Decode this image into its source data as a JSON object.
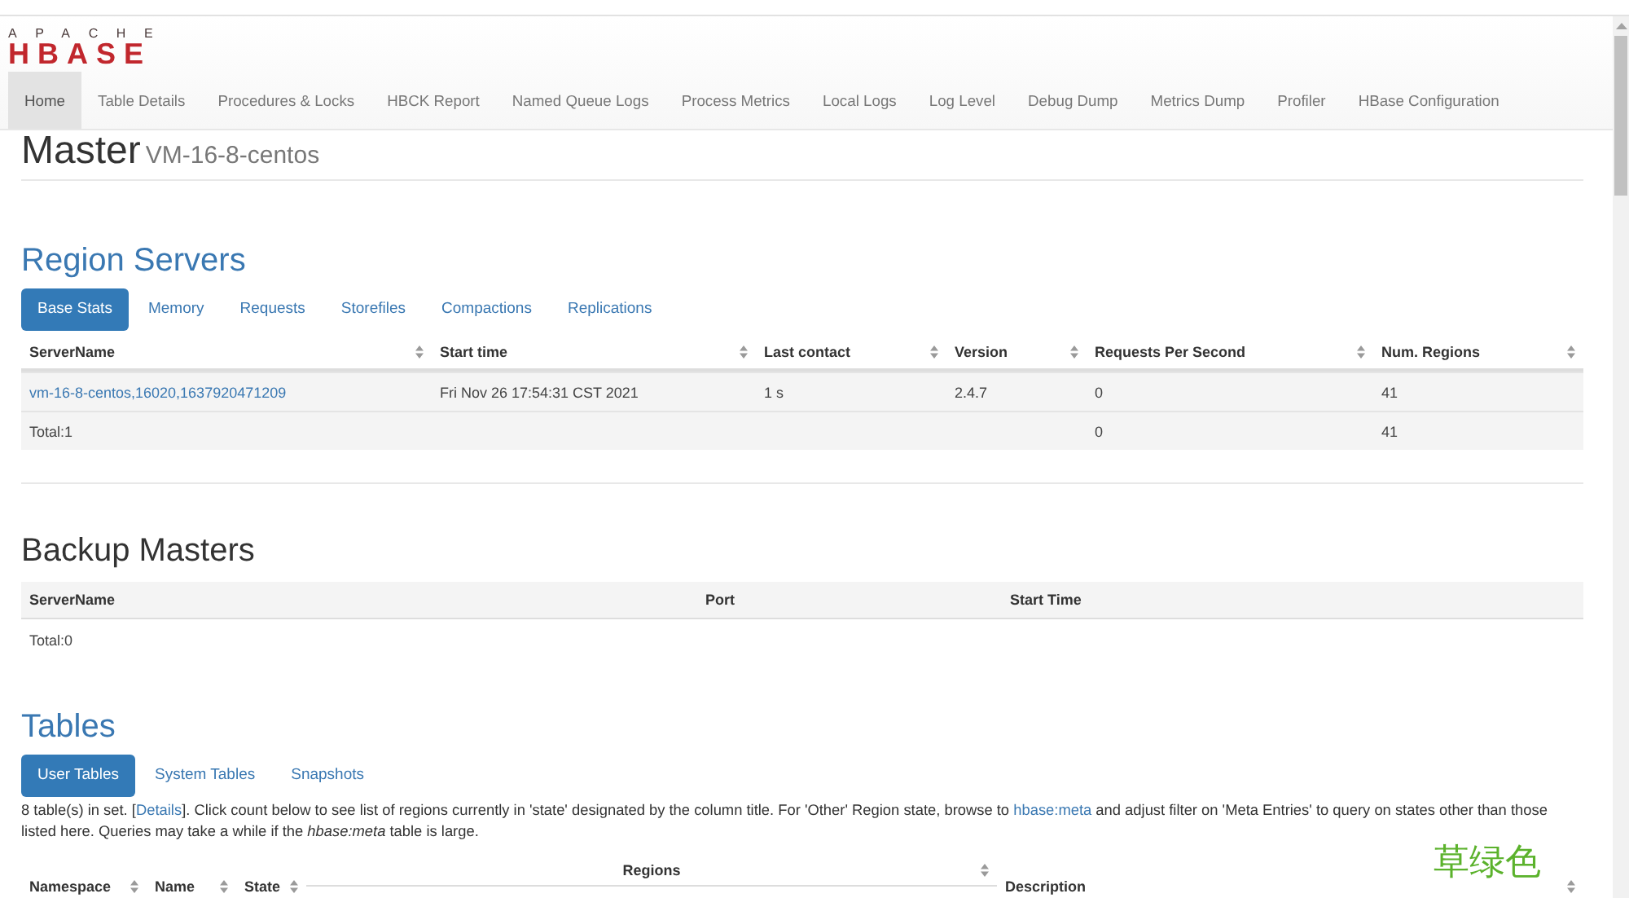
{
  "navbar": {
    "logo": {
      "tagline": "APACHE",
      "wordmark": "HBASE"
    },
    "items": [
      {
        "label": "Home",
        "selected": true
      },
      {
        "label": "Table Details",
        "selected": false
      },
      {
        "label": "Procedures & Locks",
        "selected": false
      },
      {
        "label": "HBCK Report",
        "selected": false
      },
      {
        "label": "Named Queue Logs",
        "selected": false
      },
      {
        "label": "Process Metrics",
        "selected": false
      },
      {
        "label": "Local Logs",
        "selected": false
      },
      {
        "label": "Log Level",
        "selected": false
      },
      {
        "label": "Debug Dump",
        "selected": false
      },
      {
        "label": "Metrics Dump",
        "selected": false
      },
      {
        "label": "Profiler",
        "selected": false
      },
      {
        "label": "HBase Configuration",
        "selected": false
      }
    ]
  },
  "master": {
    "title": "Master",
    "host": "VM-16-8-centos"
  },
  "region_servers": {
    "title": {
      "text": "Region Servers",
      "kind": "anchor"
    },
    "tabs": [
      {
        "label": "Base Stats",
        "selected": true
      },
      {
        "label": "Memory",
        "selected": false
      },
      {
        "label": "Requests",
        "selected": false
      },
      {
        "label": "Storefiles",
        "selected": false
      },
      {
        "label": "Compactions",
        "selected": false
      },
      {
        "label": "Replications",
        "selected": false
      }
    ],
    "table": {
      "columns": [
        {
          "label": "ServerName",
          "sortable": true
        },
        {
          "label": "Start time",
          "sortable": true
        },
        {
          "label": "Last contact",
          "sortable": true
        },
        {
          "label": "Version",
          "sortable": true
        },
        {
          "label": "Requests Per Second",
          "sortable": true
        },
        {
          "label": "Num. Regions",
          "sortable": true
        }
      ],
      "rows": [
        {
          "kind": "server",
          "cells": [
            "vm-16-8-centos,16020,1637920471209",
            "Fri Nov 26 17:54:31 CST 2021",
            "1 s",
            "2.4.7",
            "0",
            "41"
          ]
        },
        {
          "kind": "total",
          "cells": [
            "Total:1",
            null,
            null,
            null,
            "0",
            "41"
          ]
        }
      ]
    }
  },
  "backup_masters": {
    "title": {
      "text": "Backup Masters",
      "kind": "plain"
    },
    "table": {
      "columns": [
        {
          "label": "ServerName"
        },
        {
          "label": "Port"
        },
        {
          "label": "Start Time"
        }
      ],
      "rows": [
        {
          "kind": "total",
          "cells": [
            "Total:0"
          ]
        }
      ]
    }
  },
  "tables": {
    "title": {
      "text": "Tables",
      "kind": "anchor"
    },
    "tabs": [
      {
        "label": "User Tables",
        "selected": true
      },
      {
        "label": "System Tables",
        "selected": false
      },
      {
        "label": "Snapshots",
        "selected": false
      }
    ],
    "description": [
      {
        "kind": "text",
        "text": "8 table(s) in set. ["
      },
      {
        "kind": "link",
        "text": "Details"
      },
      {
        "kind": "text",
        "text": "]. Click count below to see list of regions currently in 'state' designated by the column title. For 'Other' Region state, browse to "
      },
      {
        "kind": "link",
        "text": "hbase:meta"
      },
      {
        "kind": "text",
        "text": " and adjust filter on 'Meta Entries' to query on states other than those listed here. Queries may take a while if the *hbase:meta* table is large."
      }
    ],
    "table": {
      "columns": [
        {
          "label": "Namespace",
          "sortable": true
        },
        {
          "label": "Name",
          "sortable": true
        },
        {
          "label": "State",
          "sortable": true
        },
        {
          "label": "Regions",
          "sortable": true,
          "kind": "group"
        },
        {
          "label": "Description",
          "sortable": true
        }
      ]
    }
  },
  "overlay": {
    "caption": "草绿色"
  }
}
